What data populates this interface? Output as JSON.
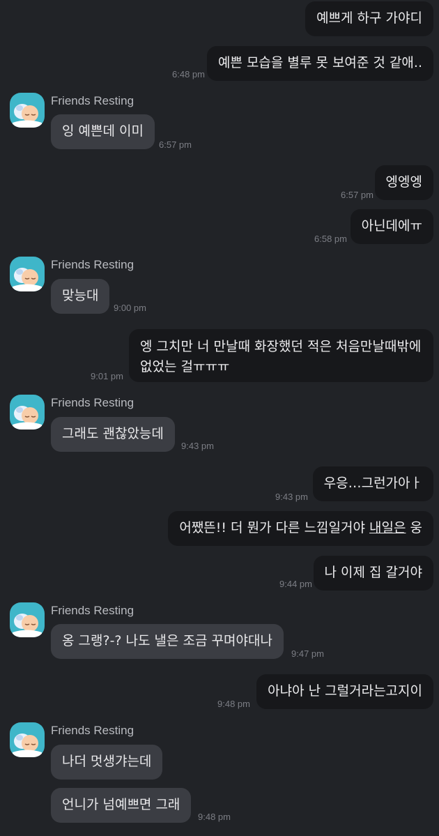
{
  "chat": {
    "contact_name": "Friends Resting",
    "messages": [
      {
        "text": "예쁘게 하구 가야디"
      },
      {
        "text": "예쁜 모습을 별루 못 보여준 것 같애..",
        "time": "6:48 pm"
      },
      {
        "text": "잉 예쁜데 이미",
        "time": "6:57 pm"
      },
      {
        "text": "엥엥엥",
        "time": "6:57 pm"
      },
      {
        "text": "아닌데에ㅠ",
        "time": "6:58 pm"
      },
      {
        "text": "맞능대",
        "time": "9:00 pm"
      },
      {
        "line1": "엥 그치만 너 만날때 화장했던 적은 처음만날때밖에",
        "line2": "없었는 걸ㅠㅠㅠ",
        "time": "9:01 pm"
      },
      {
        "text": "그래도 괜찮았능데",
        "time": "9:43 pm"
      },
      {
        "text": "우응…그런가아ㅏ",
        "time": "9:43 pm"
      },
      {
        "text_a": "어쨌뜬!! 더 뭔가 다른 느낌일거야 ",
        "text_b": "내일은",
        "text_c": " 웅"
      },
      {
        "text": "나 이제 집 갈거야",
        "time": "9:44 pm"
      },
      {
        "text": "옹 그랭?-? 나도 낼은 조금 꾸며야대나",
        "time": "9:47 pm"
      },
      {
        "text": "아냐아 난 그럴거라는고지이",
        "time": "9:48 pm"
      },
      {
        "text": "나더 멋생갸는데"
      },
      {
        "text": "언니가 넘예쁘면 그래",
        "time": "9:48 pm"
      }
    ]
  }
}
